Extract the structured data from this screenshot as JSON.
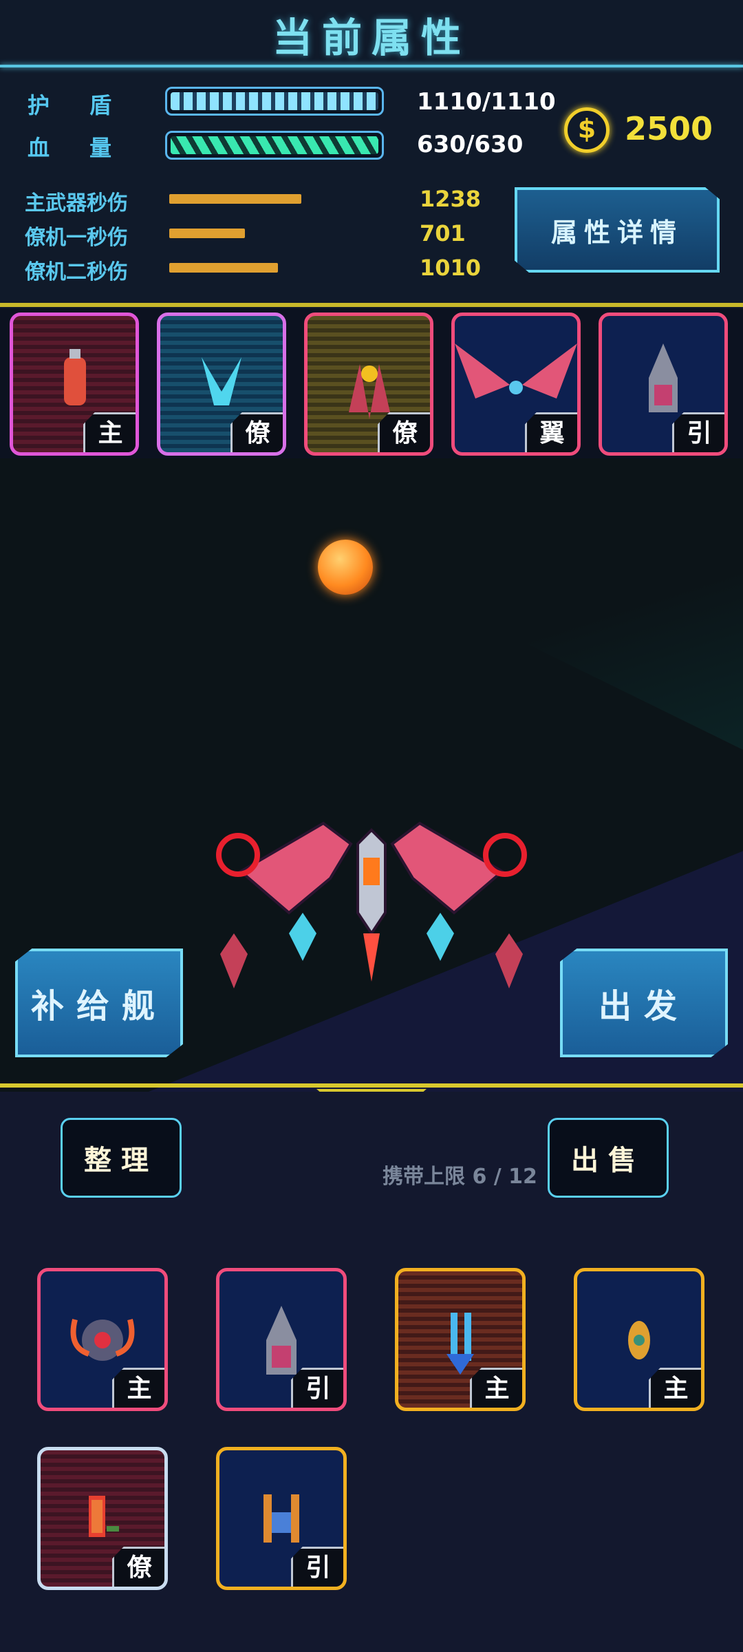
{
  "header": {
    "title": "当前属性"
  },
  "stats": {
    "shield": {
      "label": "护盾",
      "value": "1110/1110",
      "fraction": 1.0
    },
    "hp": {
      "label": "血量",
      "value": "630/630",
      "fraction": 1.0
    },
    "gold": "2500",
    "dps": [
      {
        "label": "主武器秒伤",
        "value": "1238"
      },
      {
        "label": "僚机一秒伤",
        "value": "701"
      },
      {
        "label": "僚机二秒伤",
        "value": "1010"
      }
    ],
    "detail_button": "属性详情"
  },
  "equipped": [
    {
      "tag": "主"
    },
    {
      "tag": "僚"
    },
    {
      "tag": "僚"
    },
    {
      "tag": "翼"
    },
    {
      "tag": "引"
    }
  ],
  "scene": {
    "supply_button": "补给舰",
    "depart_button": "出发"
  },
  "inventory": {
    "sort_button": "整理",
    "sell_button": "出售",
    "carry_limit": "携带上限 6 / 12",
    "items": [
      {
        "tag": "主",
        "rarity": "red"
      },
      {
        "tag": "引",
        "rarity": "red"
      },
      {
        "tag": "主",
        "rarity": "gold"
      },
      {
        "tag": "主",
        "rarity": "gold"
      },
      {
        "tag": "僚",
        "rarity": "white"
      },
      {
        "tag": "引",
        "rarity": "gold"
      }
    ]
  },
  "colors": {
    "accent_cyan": "#58c6e2",
    "gold": "#f2e03a",
    "rarity_red": "#f04c7c",
    "rarity_gold": "#f2b020",
    "rarity_white": "#c8dcf0",
    "rarity_purple": "#e056d8"
  }
}
